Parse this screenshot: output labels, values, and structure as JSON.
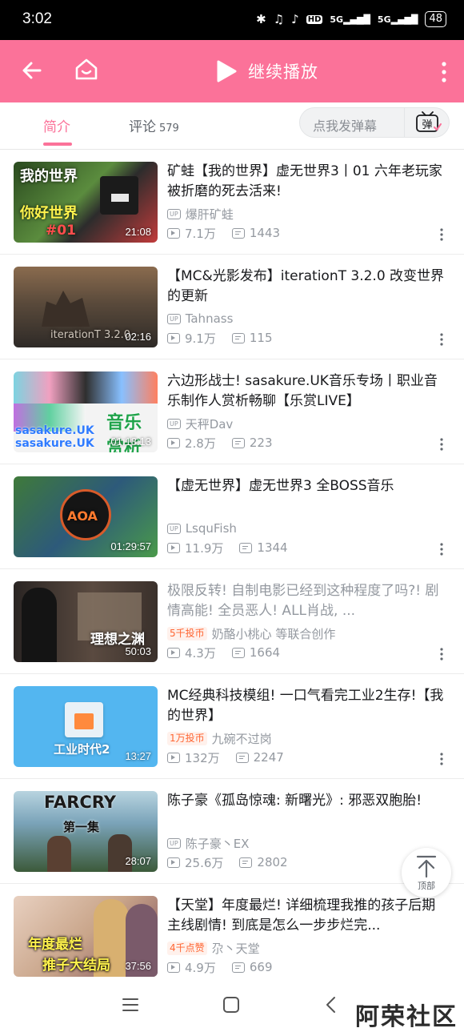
{
  "status_bar": {
    "time": "3:02",
    "hd": "HD",
    "net1": "5G",
    "net2": "5G",
    "battery": "48"
  },
  "header": {
    "title": "继续播放"
  },
  "tabs": [
    {
      "label": "简介",
      "active": true
    },
    {
      "label": "评论",
      "count": "579",
      "active": false
    }
  ],
  "danmaku": {
    "placeholder": "点我发弹幕",
    "button": "弹"
  },
  "videos": [
    {
      "title": "矿蛙【我的世界】虚无世界3丨01 六年老玩家被折磨的死去活来!",
      "owner": "爆肝矿蛙",
      "badge": "UP",
      "views": "7.1万",
      "danmaku": "1443",
      "duration": "21:08",
      "thumb_caption": "你好世界",
      "thumb_caption2": "#01",
      "thumb_bg": "#3d6b2f"
    },
    {
      "title": "【MC&光影发布】iterationT 3.2.0 改变世界的更新",
      "owner": "Tahnass",
      "badge": "UP",
      "views": "9.1万",
      "danmaku": "115",
      "duration": "02:16",
      "thumb_caption": "iterationT 3.2.0",
      "thumb_bg": "#6b5a45"
    },
    {
      "title": "六边形战士! sasakure.UK音乐专场丨职业音乐制作人赏析畅聊【乐赏LIVE】",
      "owner": "天秤Dav",
      "badge": "UP",
      "views": "2.8万",
      "danmaku": "223",
      "duration": "01:18:13",
      "thumb_caption": "音乐赏析",
      "thumb_caption2": "sasakure.UK",
      "thumb_bg": "#f3f3f3"
    },
    {
      "title": "【虚无世界】虚无世界3 全BOSS音乐",
      "owner": "LsquFish",
      "badge": "UP",
      "views": "11.9万",
      "danmaku": "1344",
      "duration": "01:29:57",
      "thumb_caption": "AOA",
      "thumb_bg": "#2d5a7a"
    },
    {
      "title": "极限反转! 自制电影已经到这种程度了吗?! 剧情高能! 全员恶人! ALL肖战, ...",
      "owner": "奶酪小桃心 等联合创作",
      "tag": "5千投币",
      "views": "4.3万",
      "danmaku": "1664",
      "duration": "50:03",
      "thumb_caption": "理想之渊",
      "thumb_bg": "#4a3e38",
      "viewed": true
    },
    {
      "title": "MC经典科技模组! 一口气看完工业2生存!【我的世界】",
      "owner": "九碗不过岗",
      "tag": "1万投币",
      "views": "132万",
      "danmaku": "2247",
      "duration": "13:27",
      "thumb_caption": "工业时代2",
      "thumb_bg": "#53b6f0"
    },
    {
      "title": "陈子豪《孤岛惊魂: 新曙光》: 邪恶双胞胎!",
      "owner": "陈子豪丶EX",
      "badge": "UP",
      "views": "25.6万",
      "danmaku": "2802",
      "duration": "28:07",
      "thumb_caption": "FARCRY",
      "thumb_caption2": "第一集",
      "thumb_bg": "#7aa3b8"
    },
    {
      "title": "【天堂】年度最烂! 详细梳理我推的孩子后期主线剧情! 到底是怎么一步步烂完...",
      "owner": "尕丶天堂",
      "tag": "4千点赞",
      "views": "4.9万",
      "danmaku": "669",
      "duration": "37:56",
      "thumb_caption": "年度最烂",
      "thumb_caption2": "推子大结局",
      "thumb_bg": "#c9a58a"
    }
  ],
  "to_top": {
    "label": "顶部"
  },
  "watermark": "阿荣社区",
  "colors": {
    "accent": "#fb7299",
    "gray_text": "#9499a0",
    "tag_orange": "#ff6633"
  }
}
